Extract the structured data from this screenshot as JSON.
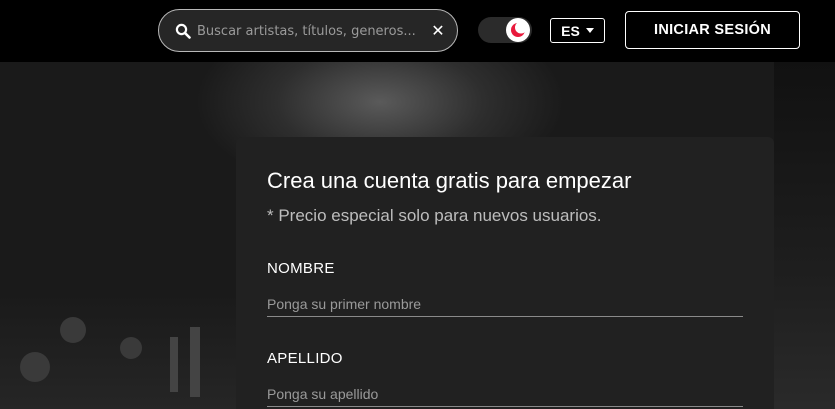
{
  "header": {
    "search": {
      "placeholder": "Buscar artistas, títulos, generos...",
      "clear_icon": "close-icon"
    },
    "theme_toggle": {
      "icon": "moon-icon",
      "accent": "#e8193c",
      "state": "dark"
    },
    "language": {
      "selected": "ES"
    },
    "login_label": "INICIAR SESIÓN"
  },
  "form": {
    "title": "Crea una cuenta gratis para empezar",
    "subtitle": "* Precio especial solo para nuevos usuarios.",
    "fields": [
      {
        "label": "NOMBRE",
        "placeholder": "Ponga su primer nombre",
        "value": ""
      },
      {
        "label": "APELLIDO",
        "placeholder": "Ponga su apellido",
        "value": ""
      }
    ]
  },
  "colors": {
    "background": "#000000",
    "card": "#212121",
    "accent": "#e8193c"
  }
}
